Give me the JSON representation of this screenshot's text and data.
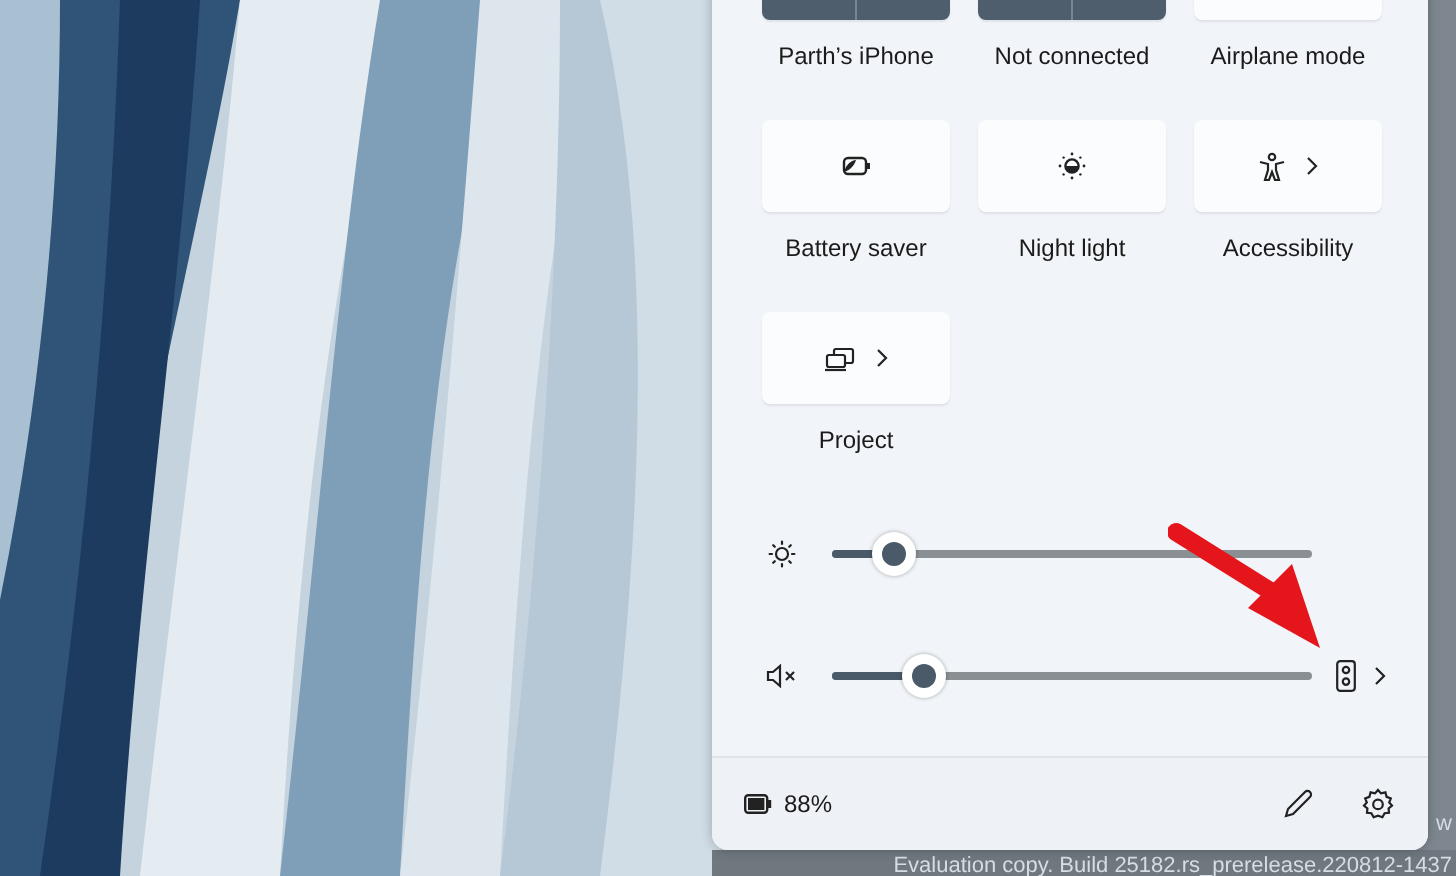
{
  "tiles": [
    {
      "label": "Parth’s iPhone",
      "kind": "split",
      "on": true
    },
    {
      "label": "Not connected",
      "kind": "split",
      "on": true
    },
    {
      "label": "Airplane mode",
      "kind": "plain",
      "on": false
    },
    {
      "label": "Battery saver",
      "kind": "battery-saver",
      "on": false,
      "chevron": false
    },
    {
      "label": "Night light",
      "kind": "night-light",
      "on": false,
      "chevron": false
    },
    {
      "label": "Accessibility",
      "kind": "accessibility",
      "on": false,
      "chevron": true
    },
    {
      "label": "Project",
      "kind": "project",
      "on": false,
      "chevron": true
    }
  ],
  "sliders": [
    {
      "kind": "brightness",
      "level": 0.13
    },
    {
      "kind": "volume",
      "level": 0.19,
      "muted": true
    }
  ],
  "footer": {
    "battery": "88%"
  },
  "desktop_text": [
    "w",
    "Evaluation copy. Build 25182.rs_prerelease.220812-1437"
  ]
}
